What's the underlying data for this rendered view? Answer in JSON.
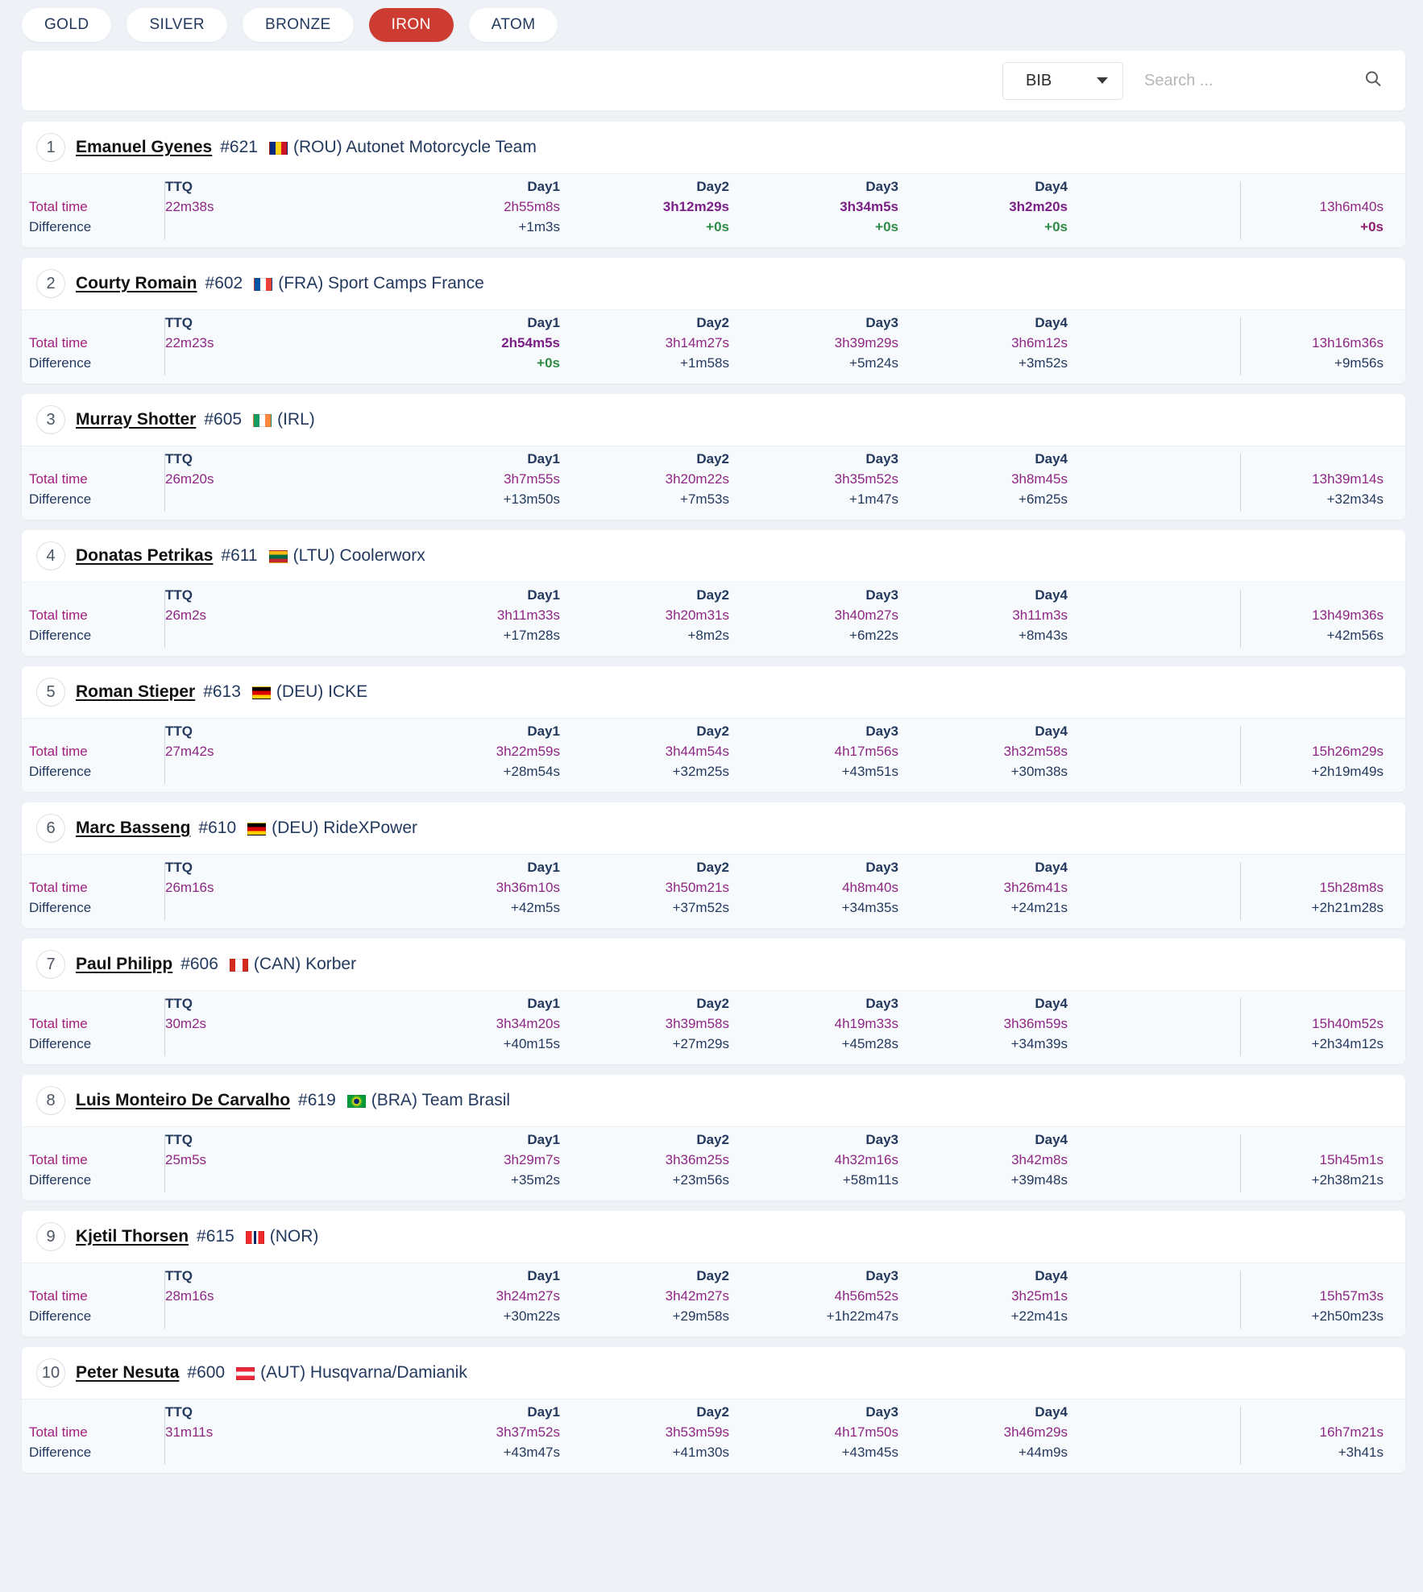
{
  "tabs": [
    {
      "label": "GOLD",
      "active": false
    },
    {
      "label": "SILVER",
      "active": false
    },
    {
      "label": "BRONZE",
      "active": false
    },
    {
      "label": "IRON",
      "active": true
    },
    {
      "label": "ATOM",
      "active": false
    }
  ],
  "search": {
    "filter_selected": "BIB",
    "filter_options": [
      "BIB"
    ],
    "placeholder": "Search ...",
    "icon": "search-icon",
    "caret_icon": "chevron-down-icon"
  },
  "colors": {
    "accent_active_tab": "#cc3c32",
    "navy": "#23395d",
    "magenta": "#a21f7c",
    "purple_time": "#8e2683",
    "green_zero": "#2e8b45",
    "page_bg": "#eef2f7",
    "stats_bg": "#f7fafd"
  },
  "column_headers": [
    "TTQ",
    "Day1",
    "Day2",
    "Day3",
    "Day4"
  ],
  "row_labels": {
    "total": "Total time",
    "difference": "Difference"
  },
  "results": [
    {
      "rank": "1",
      "name": "Emanuel Gyenes",
      "bib": "#621",
      "flag": "romania-flag",
      "country": "(ROU)",
      "team": "Autonet Motorcycle Team",
      "times": [
        "22m38s",
        "2h55m8s",
        "3h12m29s",
        "3h34m5s",
        "3h2m20s"
      ],
      "best": [
        false,
        false,
        true,
        true,
        true
      ],
      "diffs": [
        "",
        "+1m3s",
        "+0s",
        "+0s",
        "+0s"
      ],
      "total_time": "13h6m40s",
      "total_diff": "+0s"
    },
    {
      "rank": "2",
      "name": "Courty Romain",
      "bib": "#602",
      "flag": "france-flag",
      "country": "(FRA)",
      "team": "Sport Camps France",
      "times": [
        "22m23s",
        "2h54m5s",
        "3h14m27s",
        "3h39m29s",
        "3h6m12s"
      ],
      "best": [
        false,
        true,
        false,
        false,
        false
      ],
      "diffs": [
        "",
        "+0s",
        "+1m58s",
        "+5m24s",
        "+3m52s"
      ],
      "total_time": "13h16m36s",
      "total_diff": "+9m56s"
    },
    {
      "rank": "3",
      "name": "Murray Shotter",
      "bib": "#605",
      "flag": "ireland-flag",
      "country": "(IRL)",
      "team": "",
      "times": [
        "26m20s",
        "3h7m55s",
        "3h20m22s",
        "3h35m52s",
        "3h8m45s"
      ],
      "best": [
        false,
        false,
        false,
        false,
        false
      ],
      "diffs": [
        "",
        "+13m50s",
        "+7m53s",
        "+1m47s",
        "+6m25s"
      ],
      "total_time": "13h39m14s",
      "total_diff": "+32m34s"
    },
    {
      "rank": "4",
      "name": "Donatas Petrikas",
      "bib": "#611",
      "flag": "lithuania-flag",
      "country": "(LTU)",
      "team": "Coolerworx",
      "times": [
        "26m2s",
        "3h11m33s",
        "3h20m31s",
        "3h40m27s",
        "3h11m3s"
      ],
      "best": [
        false,
        false,
        false,
        false,
        false
      ],
      "diffs": [
        "",
        "+17m28s",
        "+8m2s",
        "+6m22s",
        "+8m43s"
      ],
      "total_time": "13h49m36s",
      "total_diff": "+42m56s"
    },
    {
      "rank": "5",
      "name": "Roman Stieper",
      "bib": "#613",
      "flag": "germany-flag",
      "country": "(DEU)",
      "team": "ICKE",
      "times": [
        "27m42s",
        "3h22m59s",
        "3h44m54s",
        "4h17m56s",
        "3h32m58s"
      ],
      "best": [
        false,
        false,
        false,
        false,
        false
      ],
      "diffs": [
        "",
        "+28m54s",
        "+32m25s",
        "+43m51s",
        "+30m38s"
      ],
      "total_time": "15h26m29s",
      "total_diff": "+2h19m49s"
    },
    {
      "rank": "6",
      "name": "Marc Basseng",
      "bib": "#610",
      "flag": "germany-flag",
      "country": "(DEU)",
      "team": "RideXPower",
      "times": [
        "26m16s",
        "3h36m10s",
        "3h50m21s",
        "4h8m40s",
        "3h26m41s"
      ],
      "best": [
        false,
        false,
        false,
        false,
        false
      ],
      "diffs": [
        "",
        "+42m5s",
        "+37m52s",
        "+34m35s",
        "+24m21s"
      ],
      "total_time": "15h28m8s",
      "total_diff": "+2h21m28s"
    },
    {
      "rank": "7",
      "name": "Paul Philipp",
      "bib": "#606",
      "flag": "canada-flag",
      "country": "(CAN)",
      "team": "Korber",
      "times": [
        "30m2s",
        "3h34m20s",
        "3h39m58s",
        "4h19m33s",
        "3h36m59s"
      ],
      "best": [
        false,
        false,
        false,
        false,
        false
      ],
      "diffs": [
        "",
        "+40m15s",
        "+27m29s",
        "+45m28s",
        "+34m39s"
      ],
      "total_time": "15h40m52s",
      "total_diff": "+2h34m12s"
    },
    {
      "rank": "8",
      "name": "Luis Monteiro De Carvalho",
      "bib": "#619",
      "flag": "brazil-flag",
      "country": "(BRA)",
      "team": "Team Brasil",
      "times": [
        "25m5s",
        "3h29m7s",
        "3h36m25s",
        "4h32m16s",
        "3h42m8s"
      ],
      "best": [
        false,
        false,
        false,
        false,
        false
      ],
      "diffs": [
        "",
        "+35m2s",
        "+23m56s",
        "+58m11s",
        "+39m48s"
      ],
      "total_time": "15h45m1s",
      "total_diff": "+2h38m21s"
    },
    {
      "rank": "9",
      "name": "Kjetil Thorsen",
      "bib": "#615",
      "flag": "norway-flag",
      "country": "(NOR)",
      "team": "",
      "times": [
        "28m16s",
        "3h24m27s",
        "3h42m27s",
        "4h56m52s",
        "3h25m1s"
      ],
      "best": [
        false,
        false,
        false,
        false,
        false
      ],
      "diffs": [
        "",
        "+30m22s",
        "+29m58s",
        "+1h22m47s",
        "+22m41s"
      ],
      "total_time": "15h57m3s",
      "total_diff": "+2h50m23s"
    },
    {
      "rank": "10",
      "name": "Peter Nesuta",
      "bib": "#600",
      "flag": "austria-flag",
      "country": "(AUT)",
      "team": "Husqvarna/Damianik",
      "times": [
        "31m11s",
        "3h37m52s",
        "3h53m59s",
        "4h17m50s",
        "3h46m29s"
      ],
      "best": [
        false,
        false,
        false,
        false,
        false
      ],
      "diffs": [
        "",
        "+43m47s",
        "+41m30s",
        "+43m45s",
        "+44m9s"
      ],
      "total_time": "16h7m21s",
      "total_diff": "+3h41s"
    }
  ]
}
